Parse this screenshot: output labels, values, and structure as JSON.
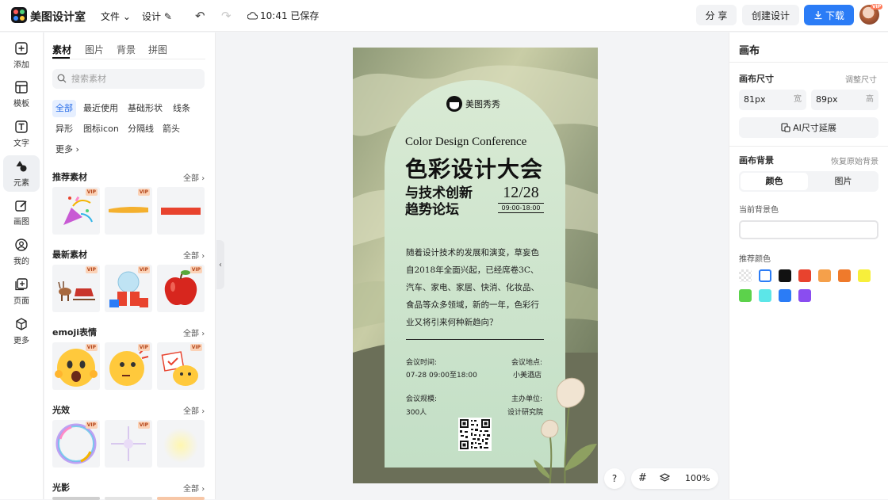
{
  "topbar": {
    "app_name": "美图设计室",
    "file_menu": "文件",
    "design_menu": "设计",
    "save_status": "10:41 已保存",
    "share_label": "分 享",
    "create_label": "创建设计",
    "download_label": "下载",
    "vip_badge": "VIP"
  },
  "leftnav": {
    "items": [
      {
        "label": "添加"
      },
      {
        "label": "模板"
      },
      {
        "label": "文字"
      },
      {
        "label": "元素"
      },
      {
        "label": "画图"
      },
      {
        "label": "我的"
      },
      {
        "label": "页面"
      },
      {
        "label": "更多"
      }
    ]
  },
  "panel": {
    "tabs": [
      "素材",
      "图片",
      "背景",
      "拼图"
    ],
    "search_placeholder": "搜索素材",
    "chips": [
      "全部",
      "最近使用",
      "基础形状",
      "线条",
      "异形",
      "图标icon",
      "分隔线",
      "箭头",
      "更多"
    ],
    "more_arrow": "›",
    "sections": [
      {
        "title": "推荐素材",
        "all": "全部"
      },
      {
        "title": "最新素材",
        "all": "全部"
      },
      {
        "title": "emoji表情",
        "all": "全部"
      },
      {
        "title": "光效",
        "all": "全部"
      },
      {
        "title": "光影",
        "all": "全部"
      }
    ],
    "vip": "VIP"
  },
  "poster": {
    "brand": "美图秀秀",
    "en_title": "Color Design Conference",
    "title": "色彩设计大会",
    "subtitle_line1": "与技术创新",
    "subtitle_line2": "趋势论坛",
    "date": "12/28",
    "time": "09:00-18:00",
    "body": "随着设计技术的发展和演变，草妄色自2018年全面兴起，已经席卷3C、汽车、家电、家居、快消、化妆品、食品等众多领域，新的一年，色彩行业又将引来何种新趋向？",
    "info": [
      {
        "label": "会议时间:",
        "value": "07-28 09:00至18:00"
      },
      {
        "label": "会议地点:",
        "value": "小美酒店"
      },
      {
        "label": "会议规模:",
        "value": "300人"
      },
      {
        "label": "主办单位:",
        "value": "设计研究院"
      }
    ]
  },
  "zoom": {
    "help": "?",
    "grid_icon": "#",
    "value": "100%"
  },
  "rpanel": {
    "title": "画布",
    "size_label": "画布尺寸",
    "adjust_link": "调整尺寸",
    "width_value": "81px",
    "width_unit": "宽",
    "height_value": "89px",
    "height_unit": "高",
    "ai_button": "AI尺寸延展",
    "bg_label": "画布背景",
    "restore_link": "恢复原始背景",
    "seg_color": "颜色",
    "seg_image": "图片",
    "current_bg_label": "当前背景色",
    "rec_label": "推荐颜色",
    "swatches": [
      "transparent",
      "#ffffff",
      "#111111",
      "#e8432e",
      "#f5a04a",
      "#ef7a2b",
      "#f7ef3b",
      "#5cd24b",
      "#5ce6e8",
      "#2b7cf6",
      "#8a4df0"
    ]
  }
}
